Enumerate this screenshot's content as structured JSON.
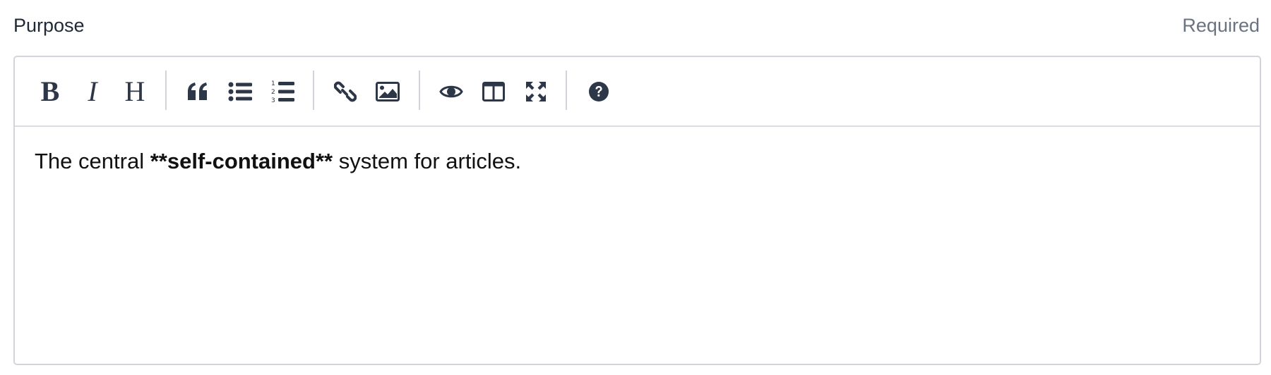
{
  "field": {
    "label": "Purpose",
    "required_text": "Required"
  },
  "toolbar": {
    "buttons": [
      {
        "name": "bold",
        "icon": "bold-icon"
      },
      {
        "name": "italic",
        "icon": "italic-icon"
      },
      {
        "name": "heading",
        "icon": "heading-icon"
      },
      {
        "name": "quote",
        "icon": "quote-icon"
      },
      {
        "name": "unordered-list",
        "icon": "unordered-list-icon"
      },
      {
        "name": "ordered-list",
        "icon": "ordered-list-icon"
      },
      {
        "name": "link",
        "icon": "link-icon"
      },
      {
        "name": "image",
        "icon": "image-icon"
      },
      {
        "name": "preview",
        "icon": "eye-icon"
      },
      {
        "name": "side-by-side",
        "icon": "columns-icon"
      },
      {
        "name": "fullscreen",
        "icon": "expand-icon"
      },
      {
        "name": "guide",
        "icon": "question-circle-icon"
      }
    ],
    "bold_glyph": "B",
    "italic_glyph": "I",
    "heading_glyph": "H"
  },
  "editor": {
    "text_before": "The central ",
    "text_bold": "**self-contained**",
    "text_after": " system for articles."
  },
  "colors": {
    "icon": "#2d3748",
    "border": "#d1d5db",
    "required": "#6b7280"
  }
}
